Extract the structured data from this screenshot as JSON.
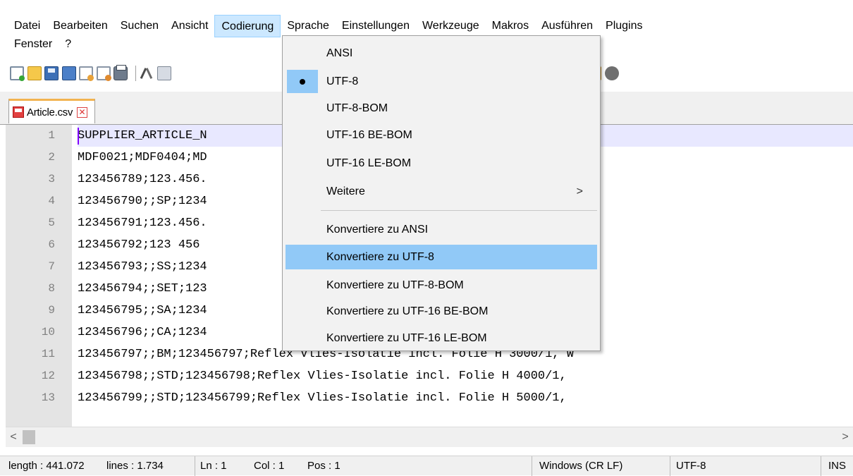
{
  "menubar": {
    "row1": [
      "Datei",
      "Bearbeiten",
      "Suchen",
      "Ansicht",
      "Codierung",
      "Sprache",
      "Einstellungen",
      "Werkzeuge",
      "Makros",
      "Ausführen",
      "Plugins"
    ],
    "row2": [
      "Fenster",
      "?"
    ]
  },
  "tab": {
    "label": "Article.csv",
    "close_glyph": "✕"
  },
  "editor": {
    "line_numbers": [
      "1",
      "2",
      "3",
      "4",
      "5",
      "6",
      "7",
      "8",
      "9",
      "10",
      "11",
      "12",
      "13"
    ],
    "lines": [
      "SUPPLIER_ARTICLE_N                        ER;ARTICLE_TYPE;SUPPLIE",
      "MDF0021;MDF0404;MD                        3;MDF0024;MDF0407;MDF00",
      "123456789;123.456.                        es-Isolatie incl. Folie",
      "123456790;;SP;1234                        incl. Folie H 4000/R, W",
      "123456791;123.456.                        s-Isolatie incl. Folie",
      "123456792;123 456                         s-Isolatie incl. Folie",
      "123456793;;SS;1234                        incl. Folie AL 3000/R3,",
      "123456794;;SET;123                         incl. Folie AL 3000/R4",
      "123456795;;SA;1234                        incl. Folie AF 3000/1, ",
      "123456796;;CA;1234                        incl. Folie AF 3000/2, ",
      "123456797;;BM;123456797;Reflex Vlies-Isolatie incl. Folie H 3000/1, W",
      "123456798;;STD;123456798;Reflex Vlies-Isolatie incl. Folie H 4000/1, ",
      "123456799;;STD;123456799;Reflex Vlies-Isolatie incl. Folie H 5000/1, "
    ]
  },
  "scrollbar": {
    "left_arrow": "<",
    "right_arrow": ">"
  },
  "statusbar": {
    "length": "length : 441.072",
    "lines": "lines : 1.734",
    "ln": "Ln : 1",
    "col": "Col : 1",
    "pos": "Pos : 1",
    "eol": "Windows (CR LF)",
    "encoding": "UTF-8",
    "mode": "INS"
  },
  "encoding_menu": {
    "items": [
      {
        "label": "ANSI"
      },
      {
        "label": "UTF-8",
        "checked": true
      },
      {
        "label": "UTF-8-BOM"
      },
      {
        "label": "UTF-16 BE-BOM"
      },
      {
        "label": "UTF-16 LE-BOM"
      },
      {
        "label": "Weitere",
        "submenu_arrow": ">"
      },
      {
        "label": "Konvertiere zu ANSI"
      },
      {
        "label": "Konvertiere zu UTF-8",
        "highlighted": true
      },
      {
        "label": "Konvertiere zu UTF-8-BOM"
      },
      {
        "label": "Konvertiere zu UTF-16 BE-BOM"
      },
      {
        "label": "Konvertiere zu UTF-16 LE-BOM"
      }
    ]
  },
  "colors": {
    "menu_active_bg": "#cce8ff",
    "menu_highlight_bg": "#91c9f7",
    "tab_accent": "#f2b350",
    "current_line_bg": "#e8e8ff",
    "gutter_bg": "#e4e4e4"
  }
}
